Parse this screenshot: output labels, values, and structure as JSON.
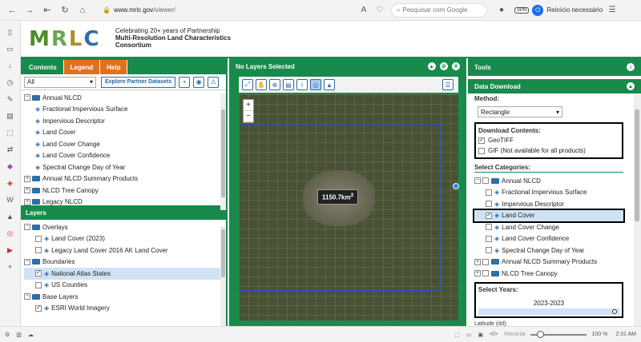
{
  "browser": {
    "url_host": "www.mrlc.gov",
    "url_path": "/viewer/",
    "search_placeholder": "Pesquisar com Google",
    "vpn": "VPN",
    "restart": "Reinício necessário"
  },
  "status_bar": {
    "reset": "Reiniciar",
    "zoom": "100 %",
    "time": "2:31 AM"
  },
  "header": {
    "logo": [
      "M",
      "R",
      "L",
      "C"
    ],
    "tagline1": "Celebrating 20+ years of Partnership",
    "tagline2": "Multi-Resolution Land Characteristics",
    "tagline3": "Consortium"
  },
  "left": {
    "tabs": [
      "Contents",
      "Legend",
      "Help"
    ],
    "filter": "All",
    "explore": "Explore Partner Datasets",
    "contents": [
      {
        "label": "Annual NLCD",
        "type": "folder",
        "toggle": "−",
        "indent": 0
      },
      {
        "label": "Fractional Impervious Surface",
        "type": "layer",
        "indent": 1
      },
      {
        "label": "Impervious Descriptor",
        "type": "layer",
        "indent": 1
      },
      {
        "label": "Land Cover",
        "type": "layer",
        "indent": 1
      },
      {
        "label": "Land Cover Change",
        "type": "layer",
        "indent": 1
      },
      {
        "label": "Land Cover Confidence",
        "type": "layer",
        "indent": 1
      },
      {
        "label": "Spectral Change Day of Year",
        "type": "layer",
        "indent": 1
      },
      {
        "label": "Annual NLCD Summary Products",
        "type": "folder",
        "toggle": "+",
        "indent": 0
      },
      {
        "label": "NLCD Tree Canopy",
        "type": "folder",
        "toggle": "+",
        "indent": 0
      },
      {
        "label": "Legacy NLCD",
        "type": "folder",
        "toggle": "+",
        "indent": 0
      }
    ],
    "layers_title": "Layers",
    "layers": [
      {
        "label": "Overlays",
        "type": "folder",
        "toggle": "−",
        "indent": 0
      },
      {
        "label": "Land Cover (2023)",
        "type": "layer",
        "check": "",
        "indent": 1
      },
      {
        "label": "Legacy Land Cover 2016 AK Land Cover",
        "type": "layer",
        "check": "",
        "indent": 1
      },
      {
        "label": "Boundaries",
        "type": "folder",
        "toggle": "−",
        "indent": 0
      },
      {
        "label": "National Atlas States",
        "type": "layer",
        "check": "✓",
        "indent": 1,
        "selected": true
      },
      {
        "label": "US Counties",
        "type": "layer",
        "check": "",
        "indent": 1
      },
      {
        "label": "Base Layers",
        "type": "folder",
        "toggle": "−",
        "indent": 0
      },
      {
        "label": "ESRI World Imagery",
        "type": "layer",
        "check": "✓",
        "indent": 1
      }
    ]
  },
  "center": {
    "title": "No Layers Selected",
    "area_value": "1150.7km",
    "area_exp": "2"
  },
  "right": {
    "tools_title": "Tools",
    "dd_title": "Data Download",
    "method_label": "Method:",
    "method_value": "Rectangle",
    "contents_label": "Download Contents:",
    "contents": [
      {
        "label": "GeoTIFF",
        "check": "✓"
      },
      {
        "label": "GIF (Not available for all products)",
        "check": ""
      }
    ],
    "categories_label": "Select Categories:",
    "categories": [
      {
        "label": "Annual NLCD",
        "type": "folder",
        "toggle": "−",
        "check": "",
        "indent": 0
      },
      {
        "label": "Fractional Impervious Surface",
        "type": "layer",
        "check": "",
        "indent": 1
      },
      {
        "label": "Impervious Descriptor",
        "type": "layer",
        "check": "",
        "indent": 1
      },
      {
        "label": "Land Cover",
        "type": "layer",
        "check": "✓",
        "indent": 1,
        "selected": true
      },
      {
        "label": "Land Cover Change",
        "type": "layer",
        "check": "",
        "indent": 1
      },
      {
        "label": "Land Cover Confidence",
        "type": "layer",
        "check": "",
        "indent": 1
      },
      {
        "label": "Spectral Change Day of Year",
        "type": "layer",
        "check": "",
        "indent": 1
      },
      {
        "label": "Annual NLCD Summary Products",
        "type": "folder",
        "toggle": "+",
        "check": "",
        "indent": 0
      },
      {
        "label": "NLCD Tree Canopy",
        "type": "folder",
        "toggle": "+",
        "check": "",
        "indent": 0
      }
    ],
    "years_label": "Select Years:",
    "years_value": "2023-2023",
    "latitude_label": "Latitude (dd):"
  }
}
